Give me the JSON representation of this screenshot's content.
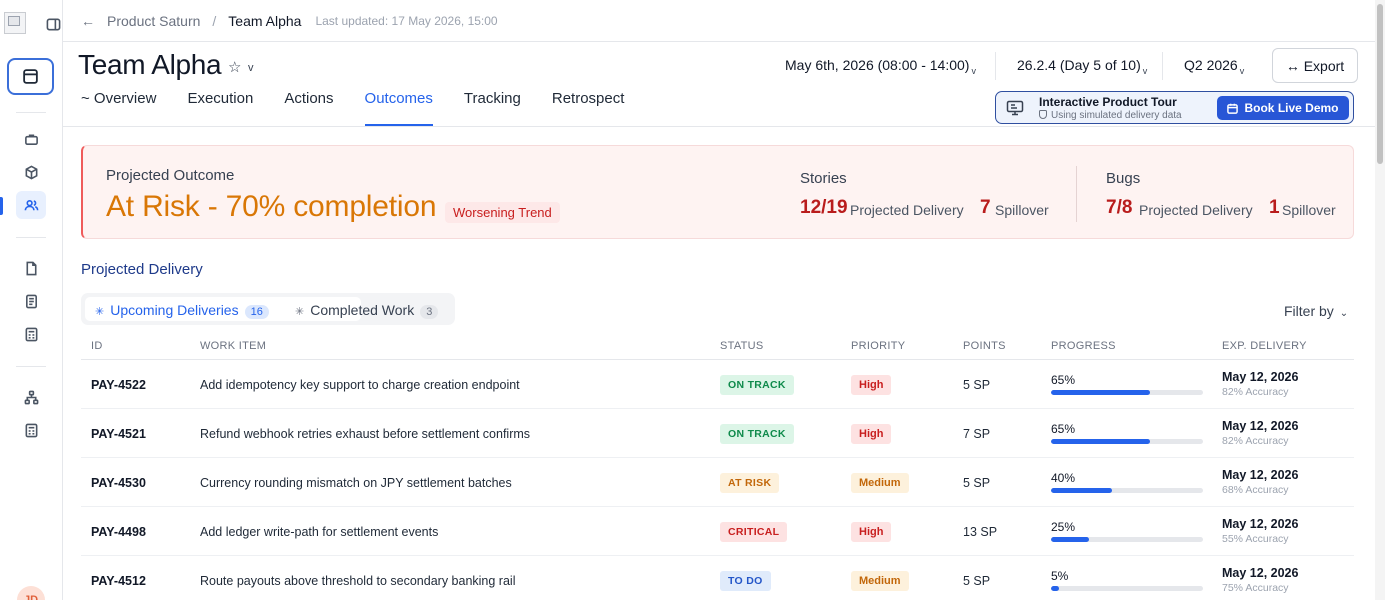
{
  "breadcrumb": {
    "back_icon": "←",
    "parent": "Product Saturn",
    "separator": "/",
    "current": "Team Alpha",
    "updated": "Last updated: 17 May 2026, 15:00"
  },
  "header": {
    "title": "Team Alpha",
    "star": "☆",
    "caret": "v",
    "date_range": "May 6th, 2026 (08:00 - 14:00)",
    "sprint": "26.2.4 (Day 5 of 10)",
    "quarter": "Q2 2026",
    "caret_small": "v",
    "export_label": "↔ Export"
  },
  "tabs": [
    {
      "label": "~ Overview"
    },
    {
      "label": "Execution"
    },
    {
      "label": "Actions"
    },
    {
      "label": "Outcomes"
    },
    {
      "label": "Tracking"
    },
    {
      "label": "Retrospect"
    }
  ],
  "tour": {
    "title": "Interactive Product Tour",
    "subtitle": "Using simulated delivery data",
    "button": "Book Live Demo"
  },
  "outcome": {
    "label": "Projected Outcome",
    "status": "At Risk - 70% completion",
    "trend": "Worsening Trend",
    "stories": {
      "heading": "Stories",
      "delivery_value": "12/19",
      "delivery_label": "Projected Delivery",
      "spill_value": "7",
      "spill_label": "Spillover"
    },
    "bugs": {
      "heading": "Bugs",
      "delivery_value": "7/8",
      "delivery_label": "Projected Delivery",
      "spill_value": "1",
      "spill_label": "Spillover"
    }
  },
  "delivery": {
    "title": "Projected Delivery",
    "upcoming_label": "Upcoming Deliveries",
    "upcoming_count": "16",
    "completed_label": "Completed Work",
    "completed_count": "3",
    "filter_label": "Filter by",
    "filter_chevron": "⌄"
  },
  "table": {
    "headers": {
      "id": "ID",
      "item": "WORK ITEM",
      "status": "STATUS",
      "priority": "PRIORITY",
      "points": "POINTS",
      "progress": "PROGRESS",
      "delivery": "EXP. DELIVERY"
    },
    "rows": [
      {
        "id": "PAY-4522",
        "item": "Add idempotency key support to charge creation endpoint",
        "status": "ON TRACK",
        "priority": "High",
        "points": "5 SP",
        "progress": "65%",
        "progress_value": 65,
        "date": "May 12, 2026",
        "accuracy": "82% Accuracy"
      },
      {
        "id": "PAY-4521",
        "item": "Refund webhook retries exhaust before settlement confirms",
        "status": "ON TRACK",
        "priority": "High",
        "points": "7 SP",
        "progress": "65%",
        "progress_value": 65,
        "date": "May 12, 2026",
        "accuracy": "82% Accuracy"
      },
      {
        "id": "PAY-4530",
        "item": "Currency rounding mismatch on JPY settlement batches",
        "status": "AT RISK",
        "priority": "Medium",
        "points": "5 SP",
        "progress": "40%",
        "progress_value": 40,
        "date": "May 12, 2026",
        "accuracy": "68% Accuracy"
      },
      {
        "id": "PAY-4498",
        "item": "Add ledger write-path for settlement events",
        "status": "CRITICAL",
        "priority": "High",
        "points": "13 SP",
        "progress": "25%",
        "progress_value": 25,
        "date": "May 12, 2026",
        "accuracy": "55% Accuracy"
      },
      {
        "id": "PAY-4512",
        "item": "Route payouts above threshold to secondary banking rail",
        "status": "TO DO",
        "priority": "Medium",
        "points": "5 SP",
        "progress": "5%",
        "progress_value": 5,
        "date": "May 12, 2026",
        "accuracy": "75% Accuracy"
      }
    ]
  },
  "user": {
    "initials": "JD"
  },
  "colors": {
    "accent": "#2563eb",
    "at_risk": "#d97706",
    "danger": "#b91c1c",
    "on_track_bg": "#dcf5e7",
    "on_track_fg": "#0f8a4b",
    "at_risk_bg": "#fdf1dc",
    "at_risk_fg": "#c2670a",
    "critical_bg": "#fde2e2",
    "critical_fg": "#c81e1e",
    "todo_bg": "#e0ebfb",
    "todo_fg": "#2456c8",
    "high_bg": "#fde2e2",
    "high_fg": "#c81e1e",
    "medium_bg": "#fdf1dc",
    "medium_fg": "#c2670a"
  }
}
